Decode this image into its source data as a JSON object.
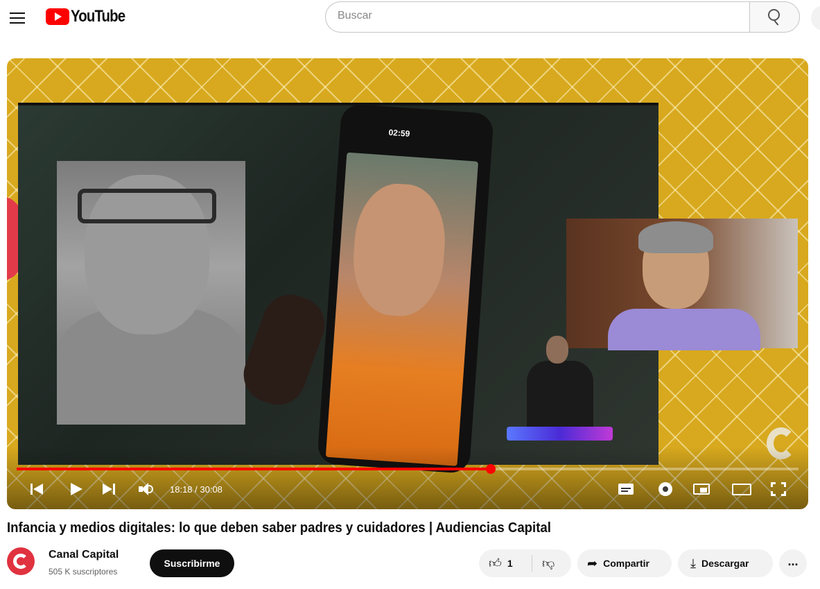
{
  "header": {
    "logo_text": "YouTube",
    "search_placeholder": "Buscar"
  },
  "player": {
    "phone_clock": "02:59",
    "current_time": "18:18",
    "duration": "30:08",
    "time_display": "18:18 / 30:08",
    "progress": 0.606,
    "accent_color": "#ff0000"
  },
  "video": {
    "title": "Infancia y medios digitales: lo que deben saber padres y cuidadores | Audiencias Capital"
  },
  "channel": {
    "name": "Canal Capital",
    "subscribers": "505 K suscriptores",
    "subscribe_label": "Suscribirme",
    "avatar_color": "#e0323f"
  },
  "actions": {
    "like_count": "1",
    "share_label": "Compartir",
    "download_label": "Descargar",
    "more_label": "..."
  },
  "icons": [
    "menu-icon",
    "search-icon",
    "mic-icon",
    "previous-icon",
    "play-icon",
    "next-icon",
    "volume-icon",
    "subtitles-icon",
    "settings-icon",
    "miniplayer-icon",
    "theater-icon",
    "fullscreen-icon",
    "like-icon",
    "dislike-icon",
    "share-icon",
    "download-icon",
    "more-icon"
  ]
}
